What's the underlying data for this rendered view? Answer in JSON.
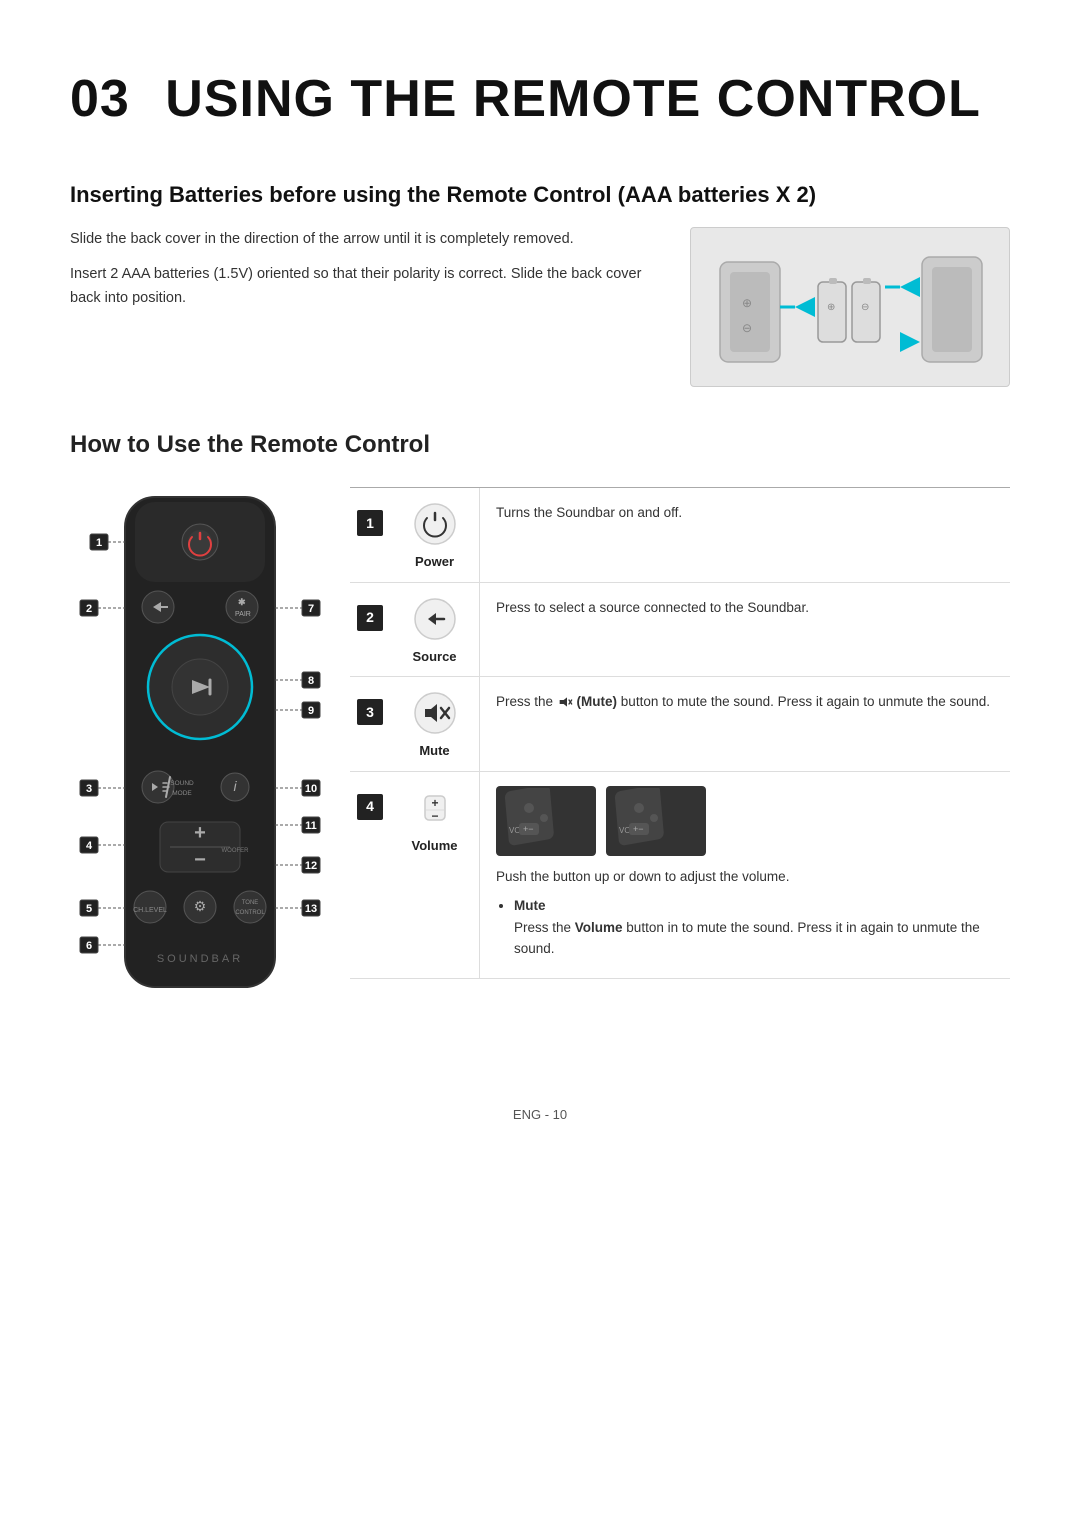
{
  "page": {
    "chapter": "03",
    "title": "USING THE REMOTE CONTROL",
    "footer": "ENG - 10"
  },
  "battery_section": {
    "heading": "Inserting Batteries before using the Remote Control (AAA batteries X 2)",
    "text1": "Slide the back cover in the direction of the arrow until it is completely removed.",
    "text2": "Insert 2 AAA batteries (1.5V) oriented so that their polarity is correct. Slide the back cover back into position."
  },
  "how_to": {
    "heading": "How to Use the Remote Control"
  },
  "controls": [
    {
      "num": "1",
      "icon": "power",
      "label": "Power",
      "desc": "Turns the Soundbar on and off."
    },
    {
      "num": "2",
      "icon": "source",
      "label": "Source",
      "desc": "Press to select a source connected to the Soundbar."
    },
    {
      "num": "3",
      "icon": "mute",
      "label": "Mute",
      "desc_prefix": "Press the",
      "desc_icon": "Mute",
      "desc_suffix": "(Mute) button to mute the sound. Press it again to unmute the sound."
    },
    {
      "num": "4",
      "icon": "volume",
      "label": "Volume",
      "desc_main": "Push the button up or down to adjust the volume.",
      "desc_bullet_title": "Mute",
      "desc_bullet": "Press the Volume button in to mute the sound. Press it in again to unmute the sound."
    }
  ],
  "remote_labels": [
    "1",
    "2",
    "3",
    "4",
    "5",
    "6",
    "7",
    "8",
    "9",
    "10",
    "11",
    "12",
    "13"
  ]
}
